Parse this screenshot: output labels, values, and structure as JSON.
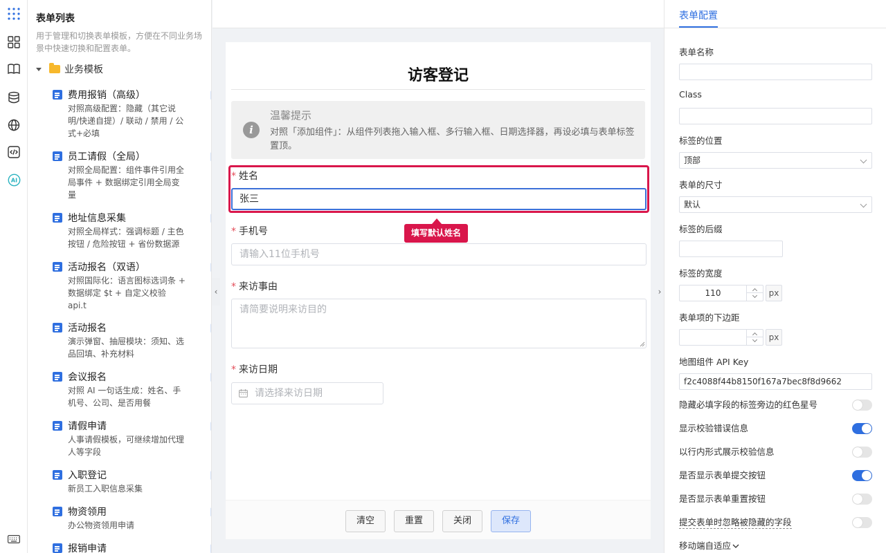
{
  "sidebar": {
    "title": "表单列表",
    "description": "用于管理和切换表单模板，方便在不同业务场景中快速切换和配置表单。",
    "folder": "业务模板",
    "templates": [
      {
        "name": "费用报销（高级）",
        "desc": "对照高级配置：隐藏（其它说明/快递自提）/ 联动 / 禁用 / 公式+必填"
      },
      {
        "name": "员工请假（全局）",
        "desc": "对照全局配置：组件事件引用全局事件 + 数据绑定引用全局变量"
      },
      {
        "name": "地址信息采集",
        "desc": "对照全局样式：强调标题 / 主色按钮 / 危险按钮 + 省份数据源"
      },
      {
        "name": "活动报名（双语）",
        "desc": "对照国际化：语言图标选词条 + 数据绑定 $t + 自定义校验 api.t"
      },
      {
        "name": "活动报名",
        "desc": "演示弹窗、抽屉模块：须知、选品回填、补充材料"
      },
      {
        "name": "会议报名",
        "desc": "对照 AI 一句话生成：姓名、手机号、公司、是否用餐"
      },
      {
        "name": "请假申请",
        "desc": "人事请假模板，可继续增加代理人等字段"
      },
      {
        "name": "入职登记",
        "desc": "新员工入职信息采集"
      },
      {
        "name": "物资领用",
        "desc": "办公物资领用申请"
      },
      {
        "name": "报销申请",
        "desc": ""
      }
    ]
  },
  "form": {
    "title": "访客登记",
    "alert": {
      "title": "温馨提示",
      "text": "对照「添加组件」：从组件列表拖入输入框、多行输入框、日期选择器，再设必填与表单标签置顶。"
    },
    "fields": {
      "name": {
        "label": "姓名",
        "value": "张三"
      },
      "phone": {
        "label": "手机号",
        "placeholder": "请输入11位手机号"
      },
      "reason": {
        "label": "来访事由",
        "placeholder": "请简要说明来访目的"
      },
      "date": {
        "label": "来访日期",
        "placeholder": "请选择来访日期"
      }
    },
    "required_mark": "*",
    "tooltip": "填写默认姓名",
    "buttons": {
      "clear": "清空",
      "reset": "重置",
      "close": "关闭",
      "save": "保存"
    }
  },
  "config": {
    "tab": "表单配置",
    "form_name_label": "表单名称",
    "form_name_value": "",
    "class_label": "Class",
    "class_value": "",
    "label_position_label": "标签的位置",
    "label_position_value": "顶部",
    "form_size_label": "表单的尺寸",
    "form_size_value": "默认",
    "label_suffix_label": "标签的后缀",
    "label_suffix_value": "",
    "label_width_label": "标签的宽度",
    "label_width_value": "110",
    "label_width_unit": "px",
    "item_margin_label": "表单项的下边距",
    "item_margin_value": "",
    "item_margin_unit": "px",
    "map_key_label": "地图组件 API Key",
    "map_key_value": "f2c4088f44b8150f167a7bec8f8d9662",
    "switches": [
      {
        "label": "隐藏必填字段的标签旁边的红色星号",
        "on": false
      },
      {
        "label": "显示校验错误信息",
        "on": true
      },
      {
        "label": "以行内形式展示校验信息",
        "on": false
      },
      {
        "label": "是否显示表单提交按钮",
        "on": true
      },
      {
        "label": "是否显示表单重置按钮",
        "on": false
      },
      {
        "label": "提交表单时忽略被隐藏的字段",
        "on": false
      }
    ],
    "mobile_label": "移动端自适应"
  },
  "colors": {
    "accent": "#2f6fe0",
    "highlight": "#d9164b",
    "required": "#e34d59"
  }
}
